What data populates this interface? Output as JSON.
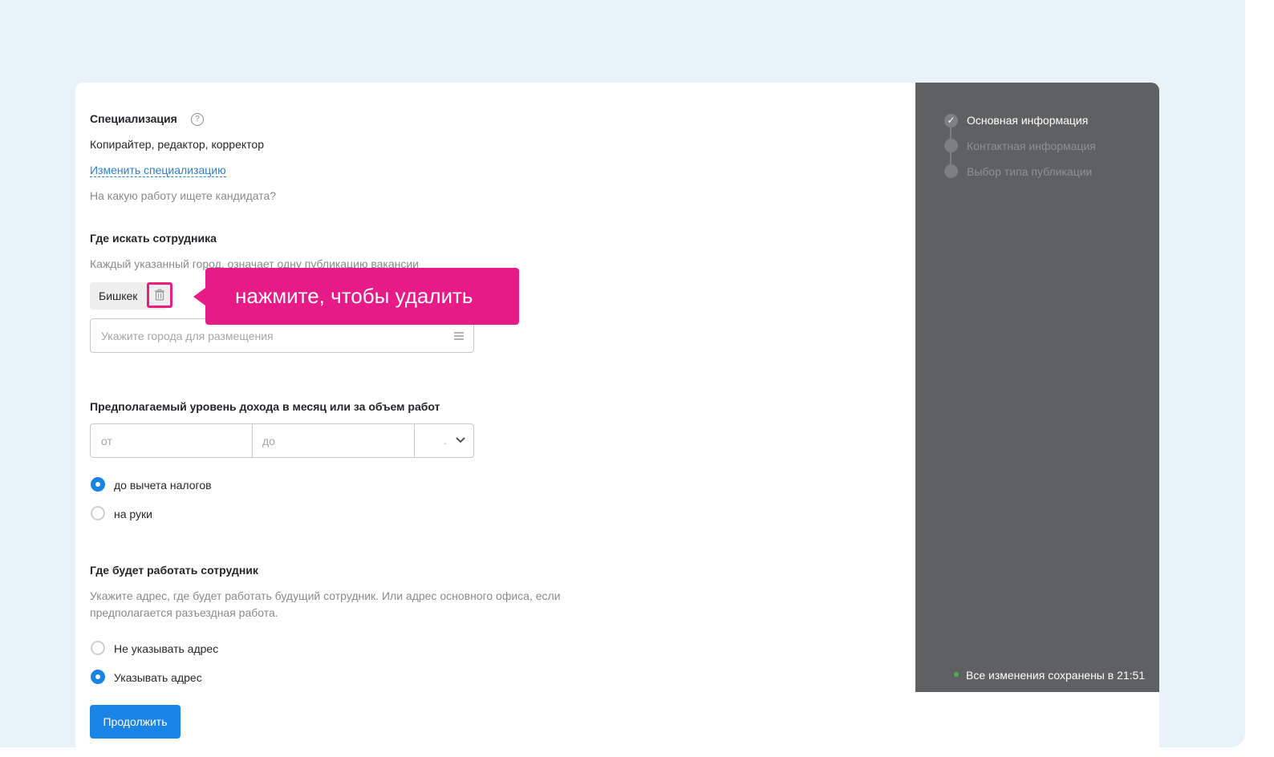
{
  "specialization": {
    "title": "Специализация",
    "help_icon": "question-circle-icon",
    "value": "Копирайтер, редактор, корректор",
    "change_link": "Изменить специализацию",
    "hint": "На какую работу ищете кандидата?"
  },
  "location": {
    "title": "Где искать сотрудника",
    "hint": "Каждый указанный город, означает одну публикацию вакансии",
    "chip_label": "Бишкек",
    "city_placeholder": "Укажите города для размещения"
  },
  "tooltip": {
    "text": "нажмите, чтобы удалить",
    "color": "#e61b87"
  },
  "salary": {
    "title": "Предполагаемый уровень дохода в месяц или за объем работ",
    "from_placeholder": "от",
    "to_placeholder": "до",
    "currency_value": ".",
    "options": [
      {
        "label": "до вычета налогов",
        "selected": true
      },
      {
        "label": "на руки",
        "selected": false
      }
    ]
  },
  "workplace": {
    "title": "Где будет работать сотрудник",
    "hint_line1": "Укажите адрес, где будет работать будущий сотрудник. Или адрес основного офиса, если",
    "hint_line2": "предполагается разъездная работа.",
    "options": [
      {
        "label": "Не указывать адрес",
        "selected": false
      },
      {
        "label": "Указывать адрес",
        "selected": true
      }
    ]
  },
  "steps": [
    {
      "label": "Основная информация",
      "state": "done"
    },
    {
      "label": "Контактная информация",
      "state": "pending"
    },
    {
      "label": "Выбор типа публикации",
      "state": "pending"
    }
  ],
  "save_status": "Все изменения сохранены в 21:51",
  "continue_button": "Продолжить",
  "colors": {
    "accent": "#1a84e6",
    "sidebar": "#5f6061",
    "page_bg": "#e7f2f9",
    "saved_dot": "#4caf50"
  }
}
